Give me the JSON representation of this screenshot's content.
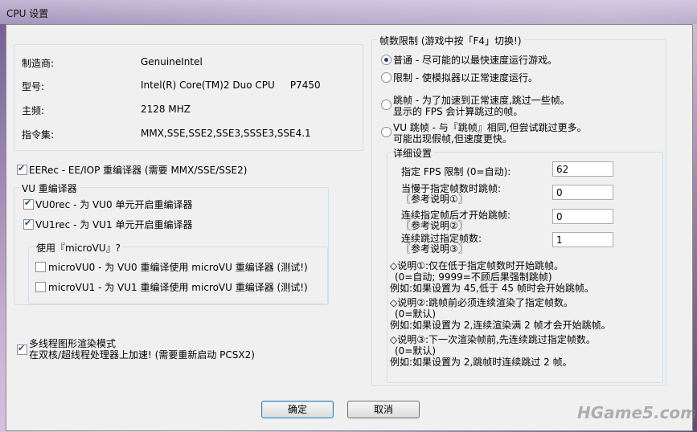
{
  "window": {
    "title": "CPU 设置"
  },
  "cpu_info": {
    "manufacturer_label": "制造商:",
    "manufacturer_value": "GenuineIntel",
    "model_label": "型号:",
    "model_value": "Intel(R) Core(TM)2 Duo CPU     P7450",
    "freq_label": "主频:",
    "freq_value": "2128 MHZ",
    "isa_label": "指令集:",
    "isa_value": "MMX,SSE,SSE2,SSE3,SSSE3,SSE4.1"
  },
  "eerec": {
    "label": "EERec - EE/IOP 重编译器 (需要 MMX/SSE/SSE2)",
    "checked": true
  },
  "vu_group": {
    "title": "VU 重编译器",
    "vu0rec": {
      "label": "VU0rec - 为 VU0 单元开启重编译器",
      "checked": true
    },
    "vu1rec": {
      "label": "VU1rec - 为 VU1 单元开启重编译器",
      "checked": true
    },
    "microvu_title": "使用『microVU』?",
    "microvu0": {
      "label": "microVU0 - 为 VU0 重编译使用 microVU 重编译器 (测试!)",
      "checked": false
    },
    "microvu1": {
      "label": "microVU1 - 为 VU1 重编译使用 microVU 重编译器 (测试!)",
      "checked": false
    }
  },
  "mtgs": {
    "line1": "多线程图形渲染模式",
    "line2": "在双核/超线程处理器上加速! (需要重新启动 PCSX2)",
    "checked": true
  },
  "frame_limit": {
    "title": "帧数限制 (游戏中按「F4」切换!)",
    "options": [
      {
        "line1": "普通 - 尽可能的以最快速度运行游戏。",
        "line2": "",
        "selected": true
      },
      {
        "line1": "限制 - 使模拟器以正常速度运行。",
        "line2": "",
        "selected": false
      },
      {
        "line1": "跳帧 - 为了加速到正常速度,跳过一些帧。",
        "line2": "显示的 FPS 会计算跳过的帧。",
        "selected": false
      },
      {
        "line1": "VU 跳帧 - 与『跳帧』相同,但尝试跳过更多。",
        "line2": "可能出现假帧,但速度更快。",
        "selected": false
      }
    ]
  },
  "details": {
    "title": "详细设置",
    "fields": [
      {
        "line1": "指定 FPS 限制 (0=自动):",
        "line2": "",
        "value": "62"
      },
      {
        "line1": "当慢于指定帧数时跳帧:",
        "line2": "〖参考说明①〗",
        "value": "0"
      },
      {
        "line1": "连续指定帧后才开始跳帧:",
        "line2": "〖参考说明②〗",
        "value": "0"
      },
      {
        "line1": "连续跳过指定帧数:",
        "line2": "〖参考说明③〗",
        "value": "1"
      }
    ],
    "notes": [
      "◇说明①:仅在低于指定帧数时开始跳帧。",
      "(0=自动; 9999=不顾后果强制跳帧)",
      "例如:如果设置为 45,低于 45 帧时会开始跳帧。",
      "◇说明②:跳帧前必须连续渲染了指定帧数。",
      "(0=默认)",
      "例如:如果设置为 2,连续渲染满 2 帧才会开始跳帧。",
      "◇说明③:下一次渲染帧前,先连续跳过指定帧数。",
      "(0=默认)",
      "例如:如果设置为 2,跳帧时连续跳过 2 帧。"
    ]
  },
  "buttons": {
    "ok": "确定",
    "cancel": "取消"
  },
  "watermark": "HGame5.com"
}
